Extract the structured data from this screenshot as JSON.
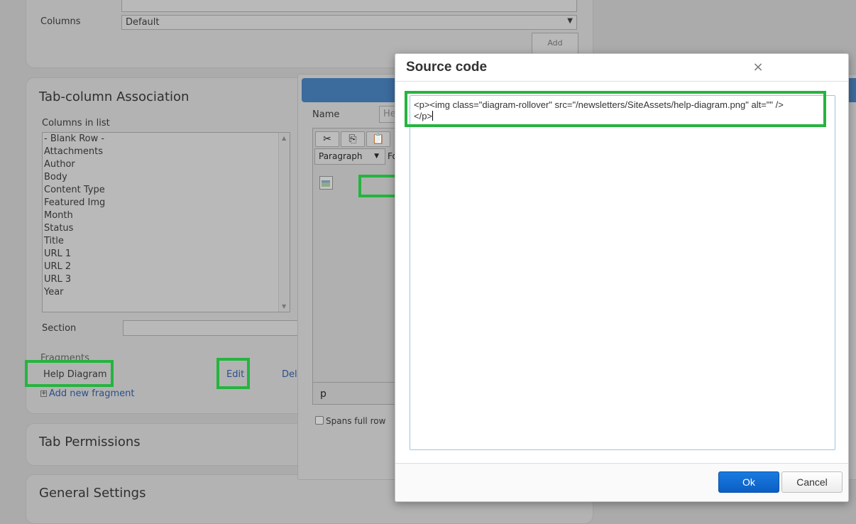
{
  "colors": {
    "overlay_bg": "#ababab",
    "annotation_green": "#25b43f",
    "ok_button": "#0b63cf",
    "code_border": "#9cc3e6"
  },
  "top_panel": {
    "columns_label": "Columns",
    "columns_value": "Default",
    "add_button": "Add"
  },
  "tab_column_association": {
    "title": "Tab-column Association",
    "columns_in_list_label": "Columns in list",
    "columns": [
      "- Blank Row -",
      "Attachments",
      "Author",
      "Body",
      "Content Type",
      "Featured Img",
      "Month",
      "Status",
      "Title",
      "URL 1",
      "URL 2",
      "URL 3",
      "Year"
    ],
    "section_label": "Section",
    "fragments_label": "Fragments",
    "fragment_name": "Help Diagram",
    "edit_link": "Edit",
    "delete_link": "Dele",
    "add_fragment_link": "Add new fragment"
  },
  "tab_permissions": {
    "title": "Tab Permissions"
  },
  "general_settings": {
    "title": "General Settings"
  },
  "fragment_dialog": {
    "name_label": "Name",
    "name_value": "He",
    "paragraph_dropdown": "Paragraph",
    "font_dropdown": "Fo",
    "status_path": "p",
    "spans_full_row_label": "Spans full row",
    "toolbar_icons": [
      "cut-icon",
      "copy-icon",
      "paste-icon"
    ]
  },
  "source_code_modal": {
    "title": "Source code",
    "close_glyph": "×",
    "code": "<p><img class=\"diagram-rollover\" src=\"/newsletters/SiteAssets/help-diagram.png\" alt=\"\" />\n</p>",
    "ok_label": "Ok",
    "cancel_label": "Cancel"
  }
}
